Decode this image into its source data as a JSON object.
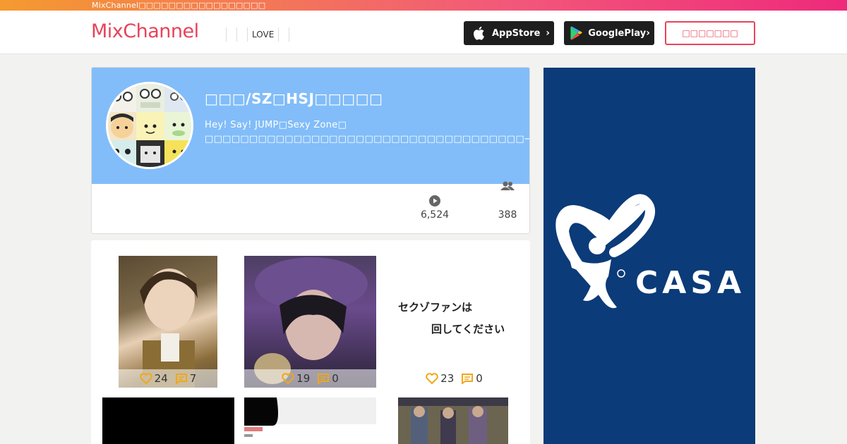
{
  "topbar": {
    "text": "MixChannel□□□□□□□□□□□□□□□□□"
  },
  "header": {
    "logo": "MixChannel",
    "nav": [
      {
        "label": ""
      },
      {
        "label": ""
      },
      {
        "label": ""
      },
      {
        "label": "LOVE"
      },
      {
        "label": ""
      }
    ],
    "appstore_label": "AppStore",
    "googleplay_label": "GooglePlay",
    "chevron": "›",
    "signup_label": "□□□□□□□"
  },
  "profile": {
    "name": "□□□/SZ□HSJ□□□□□",
    "description": "Hey! Say! JUMP□Sexy Zone□ □□□□□□□□□□□□□□□□□□□□□□□□□□□□□□□□□□□□→□□□□□□□□□□□□□□□□□□□□□□□□□□□□□□□→□□□□□□□□□□□□□□□□□□□□□□□□□□□→□□□□□□□□□□□□□□□□□□□",
    "videos_count": "6,524",
    "followers_count": "388"
  },
  "videos": [
    {
      "likes": "24",
      "comments": "7"
    },
    {
      "likes": "19",
      "comments": "0"
    },
    {
      "likes": "23",
      "comments": "0",
      "caption_line1": "セクゾファンは",
      "caption_line2": "回してください"
    }
  ],
  "ad": {
    "brand": "CASA",
    "reg": "®"
  },
  "colors": {
    "accent": "#e8435a",
    "banner": "#82bdf9",
    "ad_bg": "#0b3b78",
    "icon_orange": "#f0a818"
  }
}
